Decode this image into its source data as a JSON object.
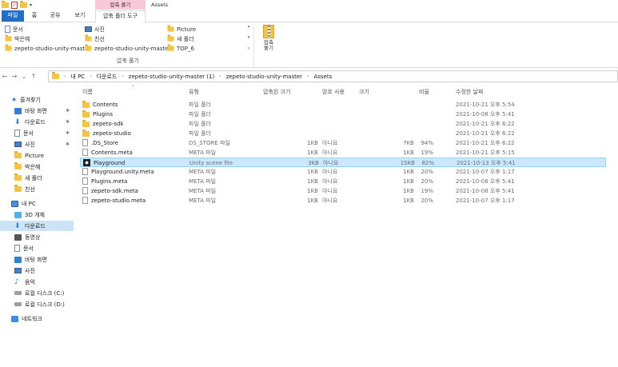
{
  "title_bar": {
    "context_tab_title": "압축 풀기",
    "window_title": "Assets",
    "dropdown_glyph": "▾"
  },
  "ribbon_tabs": [
    "파일",
    "홈",
    "공유",
    "보기",
    "압축 폴더 도구"
  ],
  "ribbon": {
    "items": [
      {
        "label": "문서",
        "icon": "document-icon"
      },
      {
        "label": "사진",
        "icon": "pictures-icon"
      },
      {
        "label": "Picture",
        "icon": "folder-icon"
      },
      {
        "label": "박은혜",
        "icon": "folder-icon"
      },
      {
        "label": "친선",
        "icon": "folder-icon"
      },
      {
        "label": "새 폴더",
        "icon": "folder-icon"
      },
      {
        "label": "zepeto-studio-unity-master",
        "icon": "folder-icon"
      },
      {
        "label": "zepeto-studio-unity-master",
        "icon": "folder-icon"
      },
      {
        "label": "TOP_6",
        "icon": "folder-icon"
      }
    ],
    "group_label": "압축 풀기",
    "extract_all_label": "압축\n풀기",
    "scroll_glyphs": [
      "▴",
      "▾",
      "▿"
    ]
  },
  "address": {
    "glyphs": {
      "back": "←",
      "forward": "→",
      "recent": "⌄",
      "up": "↑",
      "separator": "›"
    },
    "crumbs": [
      "내 PC",
      "다운로드",
      "zepeto-studio-unity-master (1)",
      "zepeto-studio-unity-master",
      "Assets"
    ]
  },
  "sidebar": {
    "quick_access": "즐겨찾기",
    "pin_glyph": "✱",
    "pinned": [
      {
        "label": "바탕 화면",
        "icon": "desktop-icon",
        "pinned": true
      },
      {
        "label": "다운로드",
        "icon": "download-icon",
        "pinned": true
      },
      {
        "label": "문서",
        "icon": "document-icon",
        "pinned": true
      },
      {
        "label": "사진",
        "icon": "pictures-icon",
        "pinned": true
      },
      {
        "label": "Picture",
        "icon": "folder-icon",
        "pinned": false
      },
      {
        "label": "박은혜",
        "icon": "folder-icon",
        "pinned": false
      },
      {
        "label": "새 폴더",
        "icon": "folder-icon",
        "pinned": false
      },
      {
        "label": "친선",
        "icon": "folder-icon",
        "pinned": false
      }
    ],
    "this_pc": "내 PC",
    "pc_items": [
      {
        "label": "3D 개체",
        "icon": "3d-objects-icon",
        "selected": false
      },
      {
        "label": "다운로드",
        "icon": "download-icon",
        "selected": true
      },
      {
        "label": "동영상",
        "icon": "videos-icon",
        "selected": false
      },
      {
        "label": "문서",
        "icon": "document-icon",
        "selected": false
      },
      {
        "label": "바탕 화면",
        "icon": "desktop-icon",
        "selected": false
      },
      {
        "label": "사진",
        "icon": "pictures-icon",
        "selected": false
      },
      {
        "label": "음악",
        "icon": "music-icon",
        "selected": false
      },
      {
        "label": "로컬 디스크 (C:)",
        "icon": "drive-icon",
        "selected": false
      },
      {
        "label": "로컬 디스크 (D:)",
        "icon": "drive-icon",
        "selected": false
      }
    ],
    "network": "네트워크"
  },
  "columns": [
    "이름",
    "유형",
    "압축된 크기",
    "암호 사용",
    "크기",
    "비율",
    "수정한 날짜"
  ],
  "sort_caret": "^",
  "files": [
    {
      "name": "Contents",
      "type": "파일 폴더",
      "packed": "",
      "encrypted": "",
      "size": "",
      "ratio": "",
      "date": "2021-10-21 오후 5:54",
      "icon": "folder",
      "selected": false
    },
    {
      "name": "Plugins",
      "type": "파일 폴더",
      "packed": "",
      "encrypted": "",
      "size": "",
      "ratio": "",
      "date": "2021-10-08 오후 5:41",
      "icon": "folder",
      "selected": false
    },
    {
      "name": "zepeto-sdk",
      "type": "파일 폴더",
      "packed": "",
      "encrypted": "",
      "size": "",
      "ratio": "",
      "date": "2021-10-21 오후 6:22",
      "icon": "folder",
      "selected": false
    },
    {
      "name": "zepeto-studio",
      "type": "파일 폴더",
      "packed": "",
      "encrypted": "",
      "size": "",
      "ratio": "",
      "date": "2021-10-21 오후 6:22",
      "icon": "folder",
      "selected": false
    },
    {
      "name": ".DS_Store",
      "type": "DS_STORE 파일",
      "packed": "1KB",
      "encrypted": "아니요",
      "size": "7KB",
      "ratio": "94%",
      "date": "2021-10-21 오후 6:22",
      "icon": "file",
      "selected": false
    },
    {
      "name": "Contents.meta",
      "type": "META 파일",
      "packed": "1KB",
      "encrypted": "아니요",
      "size": "1KB",
      "ratio": "19%",
      "date": "2021-10-21 오후 5:15",
      "icon": "file",
      "selected": false
    },
    {
      "name": "Playground",
      "type": "Unity scene file",
      "packed": "3KB",
      "encrypted": "아니요",
      "size": "15KB",
      "ratio": "82%",
      "date": "2021-10-13 오후 5:41",
      "icon": "unity",
      "selected": true
    },
    {
      "name": "Playground.unity.meta",
      "type": "META 파일",
      "packed": "1KB",
      "encrypted": "아니요",
      "size": "1KB",
      "ratio": "20%",
      "date": "2021-10-07 오후 1:17",
      "icon": "file",
      "selected": false
    },
    {
      "name": "Plugins.meta",
      "type": "META 파일",
      "packed": "1KB",
      "encrypted": "아니요",
      "size": "1KB",
      "ratio": "20%",
      "date": "2021-10-08 오후 5:41",
      "icon": "file",
      "selected": false
    },
    {
      "name": "zepeto-sdk.meta",
      "type": "META 파일",
      "packed": "1KB",
      "encrypted": "아니요",
      "size": "1KB",
      "ratio": "19%",
      "date": "2021-10-08 오후 5:41",
      "icon": "file",
      "selected": false
    },
    {
      "name": "zepeto-studio.meta",
      "type": "META 파일",
      "packed": "1KB",
      "encrypted": "아니요",
      "size": "1KB",
      "ratio": "20%",
      "date": "2021-10-07 오후 1:17",
      "icon": "file",
      "selected": false
    }
  ],
  "colors": {
    "file_tab": "#1f6fc6",
    "context_tab": "#f7c8d8",
    "selected_row": "#cce8ff",
    "selected_nav": "#cce4f7",
    "folder": "#f4c542"
  }
}
